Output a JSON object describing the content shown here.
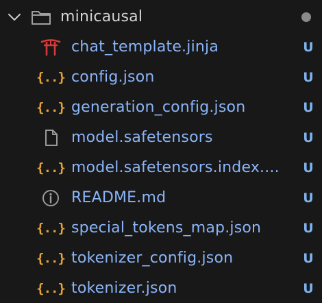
{
  "explorer": {
    "folder": {
      "name": "minicausal",
      "chevron_icon": "chevron-down-icon",
      "folder_icon": "folder-icon",
      "modified_indicator": "dot"
    },
    "files": [
      {
        "name": "chat_template.jinja",
        "status": "U",
        "icon": "jinja-torii-icon"
      },
      {
        "name": "config.json",
        "status": "U",
        "icon": "json-braces-icon"
      },
      {
        "name": "generation_config.json",
        "status": "U",
        "icon": "json-braces-icon"
      },
      {
        "name": "model.safetensors",
        "status": "U",
        "icon": "file-icon"
      },
      {
        "name": "model.safetensors.index....",
        "status": "U",
        "icon": "json-braces-icon"
      },
      {
        "name": "README.md",
        "status": "U",
        "icon": "info-icon"
      },
      {
        "name": "special_tokens_map.json",
        "status": "U",
        "icon": "json-braces-icon"
      },
      {
        "name": "tokenizer_config.json",
        "status": "U",
        "icon": "json-braces-icon"
      },
      {
        "name": "tokenizer.json",
        "status": "U",
        "icon": "json-braces-icon"
      }
    ],
    "braces_glyph": "{..}"
  },
  "colors": {
    "background": "#181818",
    "folder_text": "#d4d4d4",
    "file_text": "#8ab4f8",
    "status_untracked": "#7fb3ee",
    "json_icon": "#e2a33a",
    "jinja_icon": "#d63a3a",
    "neutral_icon": "#9a9a9a",
    "dot": "#8a8a8a"
  }
}
